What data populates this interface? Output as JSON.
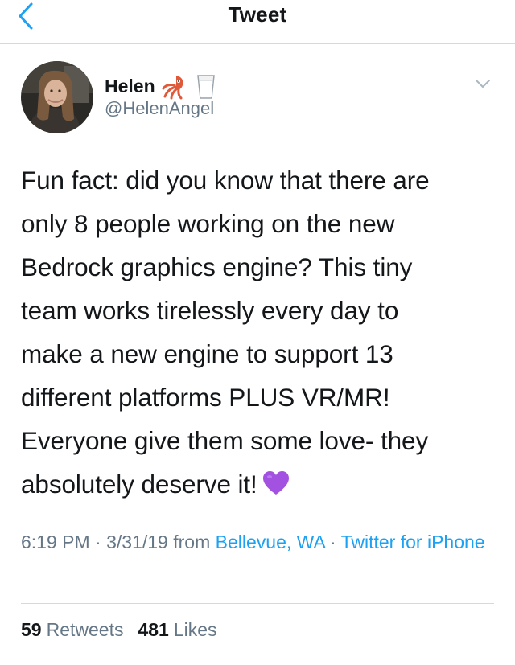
{
  "header": {
    "title": "Tweet",
    "back_icon": "chevron-left-icon",
    "accent_color": "#1da1f2"
  },
  "author": {
    "name": "Helen",
    "name_emojis": [
      "squid-emoji",
      "milk-glass-emoji"
    ],
    "handle": "@HelenAngel",
    "avatar_icon": "avatar-photo"
  },
  "tweet": {
    "lines": [
      "Fun fact: did you know that there are",
      "only 8 people working on the new",
      "Bedrock graphics engine? This tiny",
      "team works tirelessly every day to",
      "make a new engine to support 13",
      "different platforms PLUS VR/MR!",
      "Everyone give them some love- they",
      "absolutely deserve it!"
    ],
    "trailing_emoji": "purple-heart-emoji"
  },
  "meta": {
    "time": "6:19 PM",
    "sep1": " · ",
    "date": "3/31/19",
    "from": " from ",
    "location": "Bellevue, WA",
    "sep2": " · ",
    "client": "Twitter for iPhone"
  },
  "stats": {
    "retweets_count": "59",
    "retweets_label": "Retweets",
    "likes_count": "481",
    "likes_label": "Likes"
  }
}
